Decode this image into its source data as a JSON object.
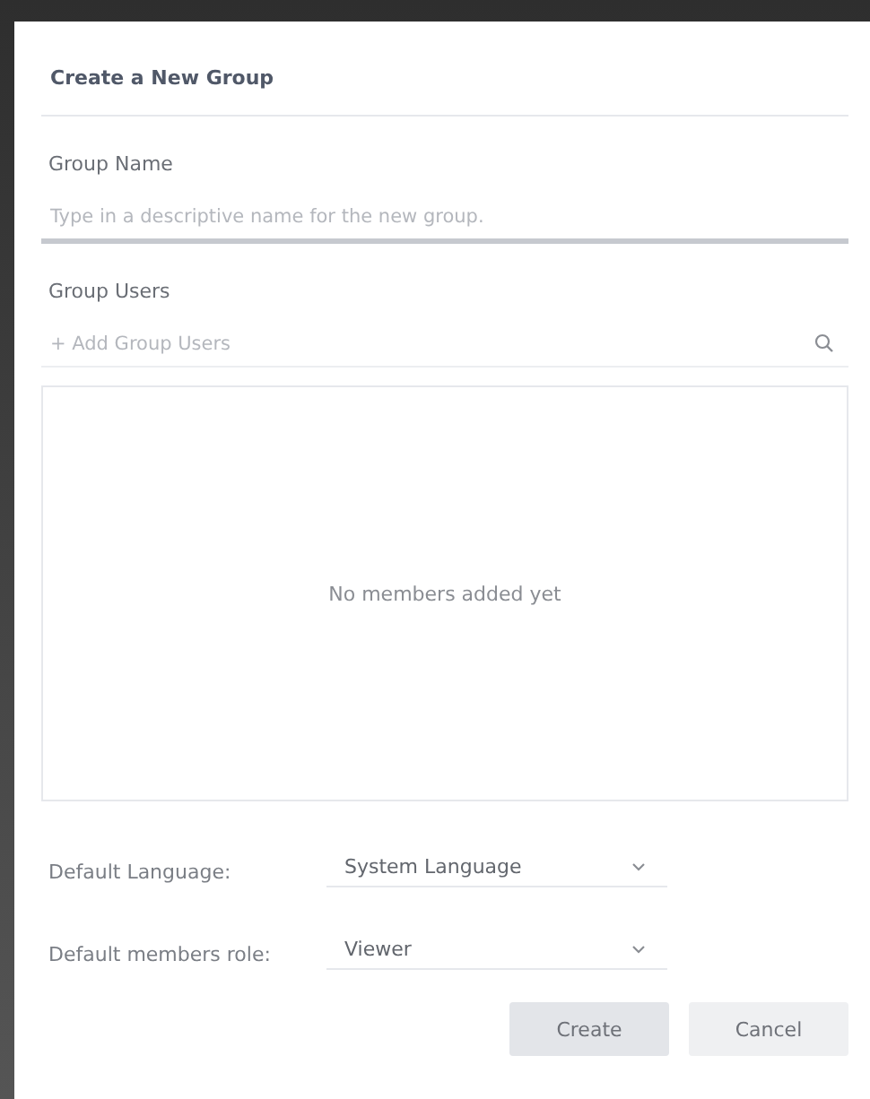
{
  "dialog": {
    "title": "Create a New Group"
  },
  "group_name": {
    "label": "Group Name",
    "placeholder": "Type in a descriptive name for the new group."
  },
  "group_users": {
    "label": "Group Users",
    "placeholder": "+ Add Group Users"
  },
  "members": {
    "empty_text": "No members added yet"
  },
  "settings": [
    {
      "label": "Default Language:",
      "value": "System Language"
    },
    {
      "label": "Default members role:",
      "value": "Viewer"
    }
  ],
  "buttons": [
    {
      "label": "Create",
      "kind": "primary"
    },
    {
      "label": "Cancel",
      "kind": "secondary"
    }
  ]
}
